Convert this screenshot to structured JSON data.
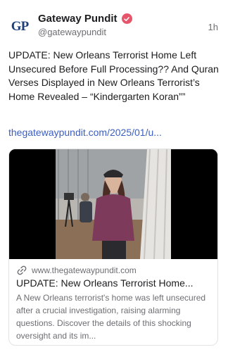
{
  "post": {
    "author_name": "Gateway Pundit",
    "author_handle": "@gatewaypundit",
    "avatar_text": "GP",
    "time": "1h",
    "text": "UPDATE: New Orleans Terrorist Home Left Unsecured Before Full Processing?? And Quran Verses Displayed in New Orleans Terrorist’s Home Revealed – “Kindergarten Koran””",
    "link_text": "thegatewaypundit.com/2025/01/u..."
  },
  "card": {
    "domain": "www.thegatewaypundit.com",
    "title": "UPDATE: New Orleans Terrorist Home...",
    "description": "A New Orleans terrorist's home was left unsecured after a crucial investigation, raising alarming questions. Discover the details of this shocking oversight and its im..."
  },
  "colors": {
    "link": "#3b5ec2",
    "verified_badge": "#e5566b",
    "muted_text": "#6e6e73"
  },
  "icons": {
    "verified": "verified-badge-icon",
    "link": "link-icon"
  }
}
